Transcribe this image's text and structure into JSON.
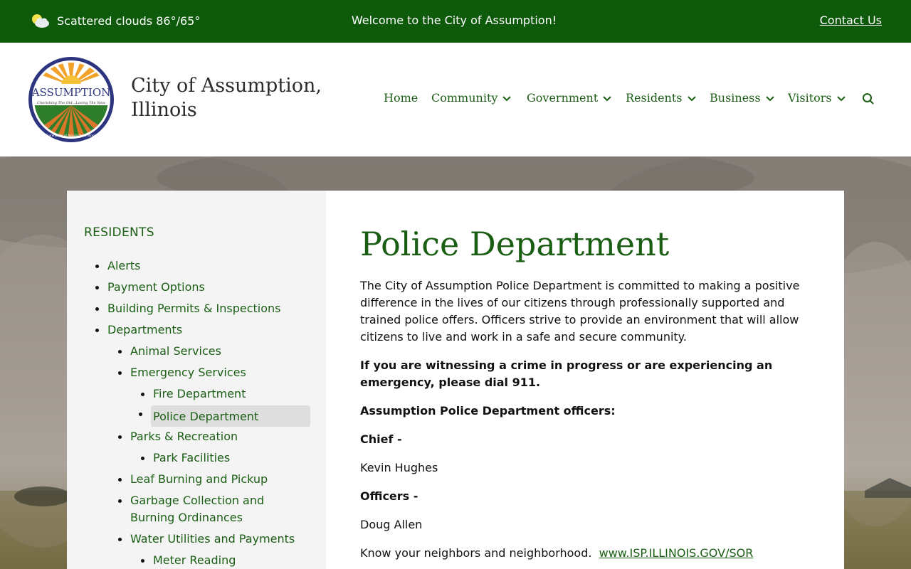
{
  "topbar": {
    "weather_text": "Scattered clouds 86°/65°",
    "weather_icon": "partly-cloudy-icon",
    "welcome": "Welcome to the City of Assumption!",
    "contact_label": "Contact Us"
  },
  "header": {
    "logo": {
      "name": "ASSUMPTION",
      "tagline": "Cherishing The Old...Loving The New",
      "ring_text": "Community of Assumption, Illinois"
    },
    "title_line1": "City of Assumption,",
    "title_line2": "Illinois"
  },
  "nav": {
    "items": [
      {
        "label": "Home",
        "dropdown": false
      },
      {
        "label": "Community",
        "dropdown": true
      },
      {
        "label": "Government",
        "dropdown": true
      },
      {
        "label": "Residents",
        "dropdown": true
      },
      {
        "label": "Business",
        "dropdown": true
      },
      {
        "label": "Visitors",
        "dropdown": true
      }
    ],
    "search_icon": "search-icon"
  },
  "sidebar": {
    "heading": "RESIDENTS",
    "items": [
      {
        "label": "Alerts",
        "level": 0
      },
      {
        "label": "Payment Options",
        "level": 0
      },
      {
        "label": "Building Permits & Inspections",
        "level": 0
      },
      {
        "label": "Departments",
        "level": 0
      },
      {
        "label": "Animal Services",
        "level": 1
      },
      {
        "label": "Emergency Services",
        "level": 1
      },
      {
        "label": "Fire Department",
        "level": 2
      },
      {
        "label": "Police Department",
        "level": 2,
        "active": true
      },
      {
        "label": "Parks & Recreation",
        "level": 1
      },
      {
        "label": "Park Facilities",
        "level": 2
      },
      {
        "label": "Leaf Burning and Pickup",
        "level": 1
      },
      {
        "label": "Garbage Collection and",
        "label2": "Burning Ordinances",
        "level": 1
      },
      {
        "label": "Water Utilities and Payments",
        "level": 1
      },
      {
        "label": "Meter Reading",
        "level": 2
      }
    ]
  },
  "main": {
    "title": "Police Department",
    "intro": "The City of Assumption Police Department is committed to making a positive difference in the lives of our citizens through professionally supported and trained police offers. Officers strive to provide an environment that will allow citizens to live and work in a safe and secure community.",
    "emergency": "If you are witnessing a crime in progress or are experiencing an emergency, please dial 911.",
    "officers_heading": "Assumption Police Department officers:",
    "chief_label": "Chief -",
    "chief_name": "Kevin Hughes",
    "officers_label": "Officers -",
    "officer_name": "Doug Allen",
    "neighbors_text": "Know your neighbors and neighborhood.",
    "neighbors_link": "www.ISP.ILLINOIS.GOV/SOR"
  },
  "colors": {
    "brand_green": "#0d5a0a",
    "link_green": "#1a5e14"
  }
}
